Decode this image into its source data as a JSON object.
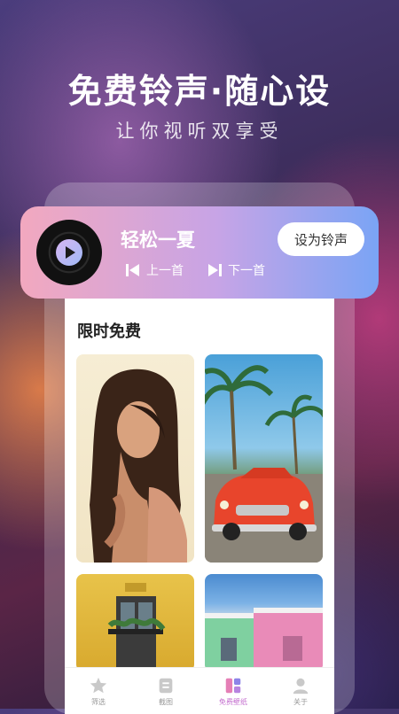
{
  "headline": "免费铃声·随心设",
  "subline": "让你视听双享受",
  "player": {
    "song_title": "轻松一夏",
    "prev_label": "上一首",
    "next_label": "下一首",
    "set_ringtone_label": "设为铃声"
  },
  "section_title": "限时免费",
  "tabs": [
    {
      "label": "筛选",
      "icon": "star-icon"
    },
    {
      "label": "截图",
      "icon": "screenshot-icon"
    },
    {
      "label": "免费壁纸",
      "icon": "wallpaper-icon",
      "active": true
    },
    {
      "label": "关于",
      "icon": "person-icon"
    }
  ],
  "colors": {
    "accent": "#c46fcf",
    "player_gradient_start": "#f2a8bf",
    "player_gradient_end": "#7aa4f5"
  }
}
